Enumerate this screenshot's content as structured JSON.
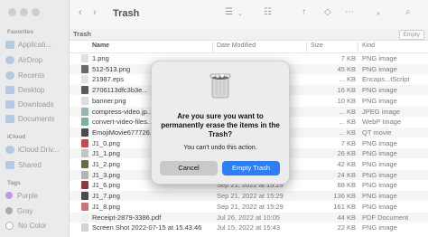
{
  "window": {
    "title": "Trash"
  },
  "sidebar": {
    "favorites_header": "Favorites",
    "favorites": [
      {
        "label": "Applicati..."
      },
      {
        "label": "AirDrop"
      },
      {
        "label": "Recents"
      },
      {
        "label": "Desktop"
      },
      {
        "label": "Downloads"
      },
      {
        "label": "Documents"
      }
    ],
    "icloud_header": "iCloud",
    "icloud": [
      {
        "label": "iCloud Driv..."
      },
      {
        "label": "Shared"
      }
    ],
    "tags_header": "Tags",
    "tags": [
      {
        "label": "Purple",
        "color": "#b58ee0"
      },
      {
        "label": "Gray",
        "color": "#a0a0a0"
      },
      {
        "label": "No Color",
        "color": "#ffffff"
      }
    ]
  },
  "toolbar": {
    "back_icon": "chevron-left-icon",
    "forward_icon": "chevron-right-icon",
    "view_icon": "list-view-icon",
    "grid_icon": "grid-view-icon",
    "share_icon": "share-icon",
    "tag_icon": "tag-icon"
  },
  "pathbar": {
    "label": "Trash",
    "empty_button": "Empty"
  },
  "columns": {
    "name": "Name",
    "date": "Date Modified",
    "size": "Size",
    "kind": "Kind"
  },
  "files": [
    {
      "name": "1.png",
      "date": "",
      "size": "7 KB",
      "kind": "PNG image",
      "thumb": "#dcdcdc"
    },
    {
      "name": "512-513.png",
      "date": "",
      "size": "45 KB",
      "kind": "PNG image",
      "thumb": "#555"
    },
    {
      "name": "21987.eps",
      "date": "",
      "size": "... KB",
      "kind": "Encaps...tScript",
      "thumb": "#e0e0e0"
    },
    {
      "name": "2706113dfc3b3e...",
      "date": "",
      "size": "16 KB",
      "kind": "PNG image",
      "thumb": "#444"
    },
    {
      "name": "banner.png",
      "date": "",
      "size": "10 KB",
      "kind": "PNG image",
      "thumb": "#d9d9d9"
    },
    {
      "name": "compress-video.jp...",
      "date": "",
      "size": "... KB",
      "kind": "JPEG image",
      "thumb": "#8aa"
    },
    {
      "name": "convert-video-files...",
      "date": "",
      "size": "... KB",
      "kind": "WebP Image",
      "thumb": "#6a8"
    },
    {
      "name": "EmojiMovie677726...",
      "date": "",
      "size": "... KB",
      "kind": "QT movie",
      "thumb": "#333"
    },
    {
      "name": "J1_0.png",
      "date": "",
      "size": "7 KB",
      "kind": "PNG image",
      "thumb": "#b33"
    },
    {
      "name": "J1_1.png",
      "date": "",
      "size": "26 KB",
      "kind": "PNG image",
      "thumb": "#bbb"
    },
    {
      "name": "J1_2.png",
      "date": "",
      "size": "42 KB",
      "kind": "PNG image",
      "thumb": "#553"
    },
    {
      "name": "J1_3.png",
      "date": "",
      "size": "24 KB",
      "kind": "PNG image",
      "thumb": "#aaa"
    },
    {
      "name": "J1_6.png",
      "date": "Sep 21, 2022 at 15:29",
      "size": "88 KB",
      "kind": "PNG image",
      "thumb": "#722"
    },
    {
      "name": "J1_7.png",
      "date": "Sep 21, 2022 at 15:29",
      "size": "136 KB",
      "kind": "PNG image",
      "thumb": "#333"
    },
    {
      "name": "J1_8.png",
      "date": "Sep 21, 2022 at 15:29",
      "size": "161 KB",
      "kind": "PNG image",
      "thumb": "#b66"
    },
    {
      "name": "Receipt-2879-3386.pdf",
      "date": "Jul 26, 2022 at 10:05",
      "size": "44 KB",
      "kind": "PDF Document",
      "thumb": "#eee"
    },
    {
      "name": "Screen Shot 2022-07-15 at 15.43.46",
      "date": "Jul 15, 2022 at 15:43",
      "size": "22 KB",
      "kind": "PNG image",
      "thumb": "#ccc"
    }
  ],
  "dialog": {
    "icon": "trash-bin-icon",
    "title": "Are you sure you want to permanently erase the items in the Trash?",
    "message": "You can't undo this action.",
    "cancel_label": "Cancel",
    "confirm_label": "Empty Trash"
  }
}
